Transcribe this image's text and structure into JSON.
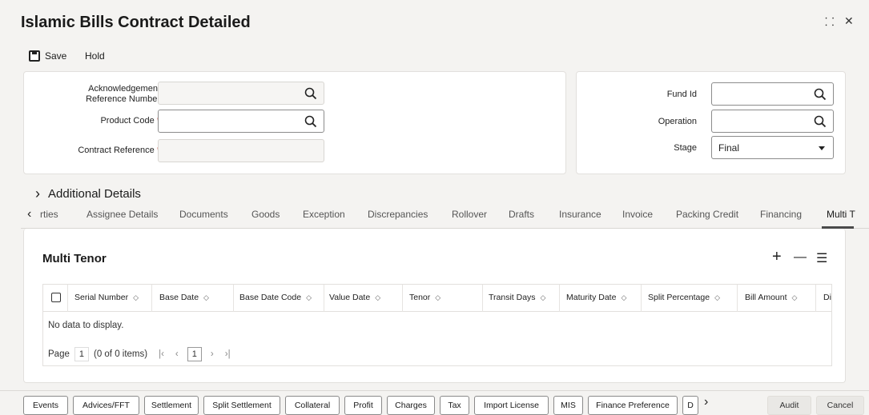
{
  "window": {
    "title": "Islamic Bills Contract Detailed",
    "restore_glyph": "⸬",
    "close_glyph": "✕"
  },
  "toolbar": {
    "save_label": "Save",
    "hold_label": "Hold"
  },
  "left_panel": {
    "ack_label_line1": "Acknowledgement",
    "ack_label_line2": "Reference Number",
    "ack_value": "",
    "product_code_label": "Product Code",
    "product_code_value": "",
    "contract_ref_label": "Contract Reference",
    "contract_ref_value": "",
    "required_mark": "*"
  },
  "right_panel": {
    "fund_id_label": "Fund Id",
    "fund_id_value": "",
    "operation_label": "Operation",
    "operation_value": "",
    "stage_label": "Stage",
    "stage_value": "Final"
  },
  "additional_details": {
    "label": "Additional Details",
    "chevron": "›"
  },
  "tabs": {
    "scroll_left": "‹",
    "items": [
      "rties",
      "Assignee Details",
      "Documents",
      "Goods",
      "Exception",
      "Discrepancies",
      "Rollover",
      "Drafts",
      "Insurance",
      "Invoice",
      "Packing Credit",
      "Financing",
      "Multi T"
    ],
    "active_index": 12
  },
  "multi_tenor": {
    "title": "Multi Tenor",
    "add_glyph": "+",
    "remove_glyph": "—",
    "columns_glyph": "☰",
    "columns": [
      "Serial Number",
      "Base Date",
      "Base Date Code",
      "Value Date",
      "Tenor",
      "Transit Days",
      "Maturity Date",
      "Split Percentage",
      "Bill Amount",
      "Di"
    ],
    "sort_glyph": "◇",
    "no_data": "No data to display.",
    "pager": {
      "page_label": "Page",
      "page_input": "1",
      "items_info": "(0 of 0 items)",
      "first": "|‹",
      "prev": "‹",
      "current": "1",
      "next": "›",
      "last": "›|"
    }
  },
  "footer": {
    "buttons": [
      "Events",
      "Advices/FFT",
      "Settlement",
      "Split Settlement",
      "Collateral",
      "Profit",
      "Charges",
      "Tax",
      "Import License",
      "MIS",
      "Finance Preference",
      "D"
    ],
    "more_glyph": "›",
    "audit_label": "Audit",
    "cancel_label": "Cancel"
  }
}
